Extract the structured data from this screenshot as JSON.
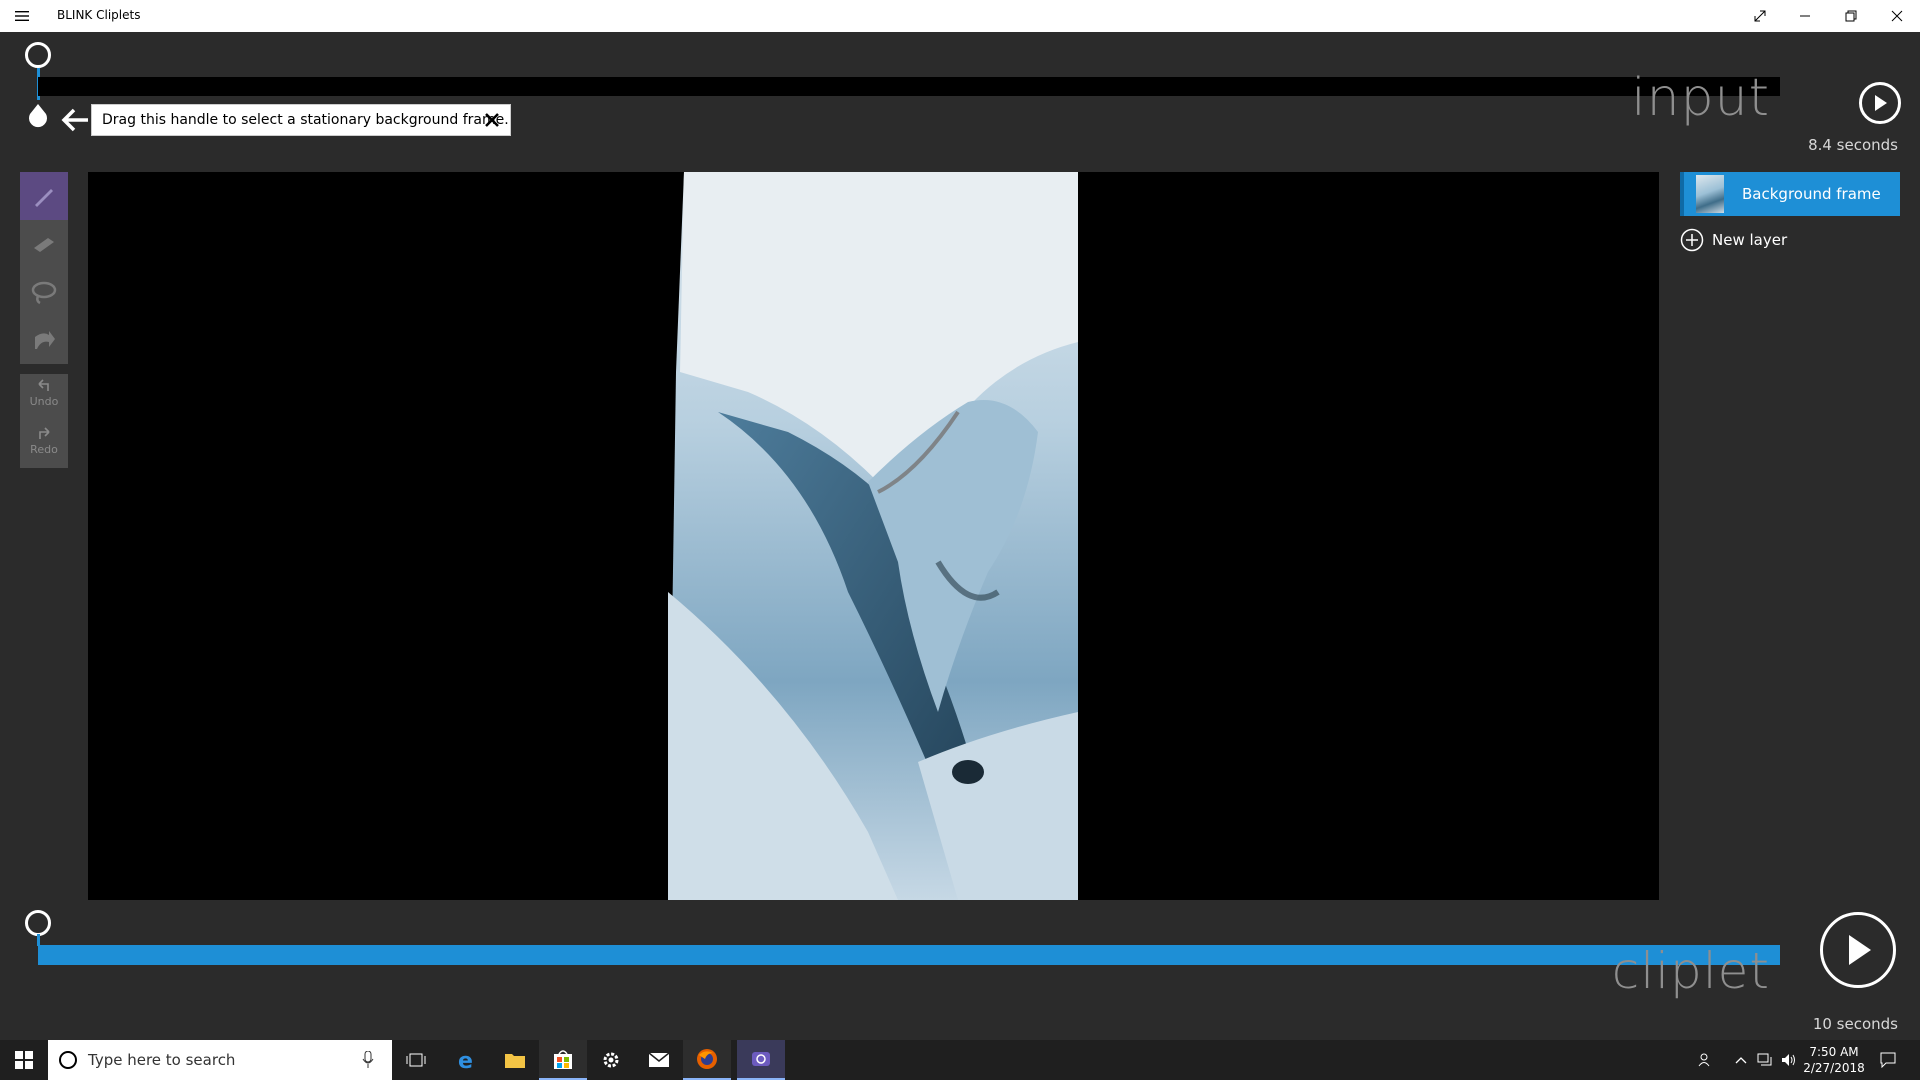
{
  "app": {
    "title": "BLINK Cliplets"
  },
  "input_timeline": {
    "label": "input",
    "duration": "8.4 seconds"
  },
  "tooltip": {
    "text": "Drag this handle to select a stationary background frame."
  },
  "tools": {
    "undo_label": "Undo",
    "redo_label": "Redo"
  },
  "layers": [
    {
      "label": "Background frame",
      "selected": true
    }
  ],
  "new_layer_label": "New layer",
  "cliplet_timeline": {
    "label": "cliplet",
    "duration": "10 seconds"
  },
  "taskbar": {
    "search_placeholder": "Type here to search",
    "time": "7:50 AM",
    "date": "2/27/2018"
  },
  "colors": {
    "accent": "#1e8fd6",
    "tool_active": "#5c4a82",
    "background": "#2b2b2b"
  }
}
